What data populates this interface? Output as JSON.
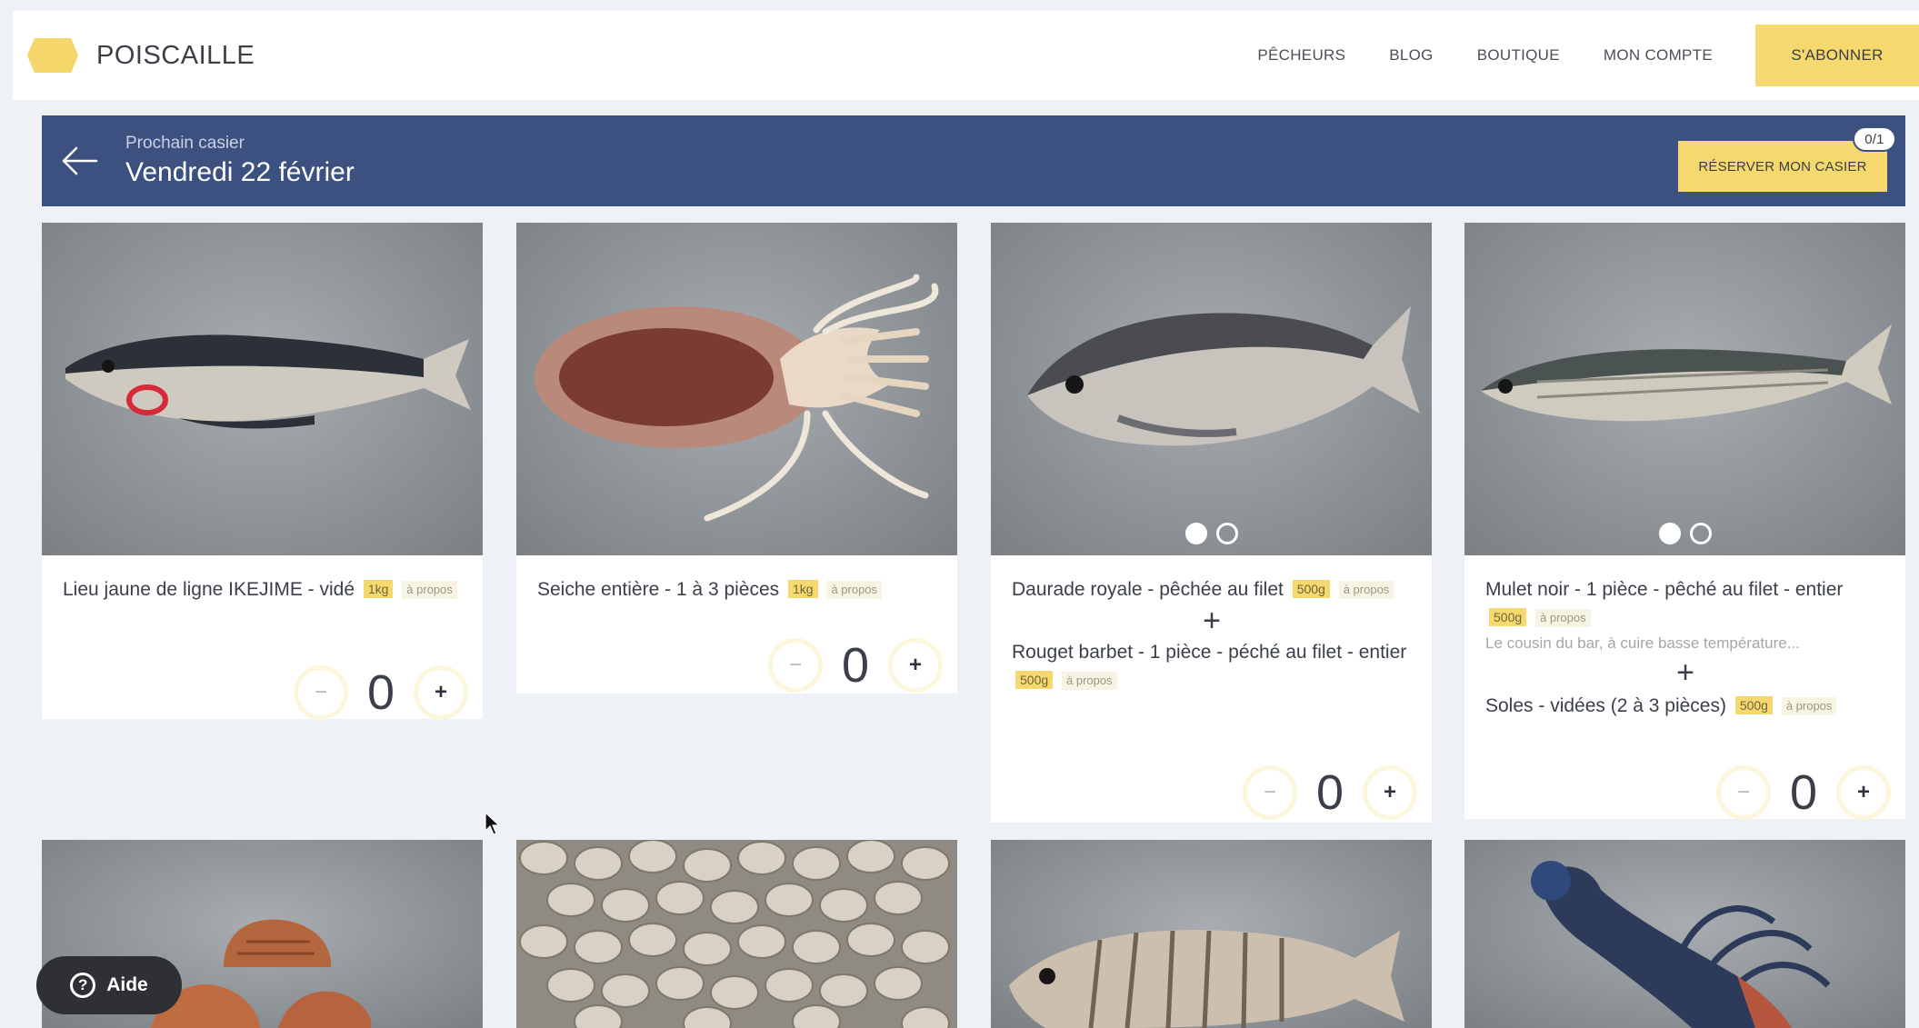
{
  "brand": {
    "name": "POISCAILLE",
    "color": "#f4d66b"
  },
  "nav": {
    "items": [
      "PÊCHEURS",
      "BLOG",
      "BOUTIQUE",
      "MON COMPTE"
    ],
    "subscribe": "S'ABONNER"
  },
  "banner": {
    "label": "Prochain casier",
    "date": "Vendredi 22 février",
    "reserve": "RÉSERVER MON CASIER",
    "badge": "0/1",
    "color": "#3c5180"
  },
  "cards": [
    {
      "photo_icon": "pollock-photo",
      "items": [
        {
          "title": "Lieu jaune de ligne IKEJIME - vidé",
          "weight": "1kg",
          "about": "à propos"
        }
      ],
      "quantity": "0"
    },
    {
      "photo_icon": "cuttlefish-photo",
      "items": [
        {
          "title": "Seiche entière - 1 à 3 pièces",
          "weight": "1kg",
          "about": "à propos"
        }
      ],
      "quantity": "0"
    },
    {
      "photo_icon": "sea-bream-photo",
      "carousel": {
        "count": 2,
        "active": 1
      },
      "items": [
        {
          "title": "Daurade royale - pêchée au filet",
          "weight": "500g",
          "about": "à propos"
        },
        {
          "title": "Rouget barbet - 1 pièce - péché au filet - entier",
          "weight": "500g",
          "about": "à propos"
        }
      ],
      "separator": "+",
      "quantity": "0"
    },
    {
      "photo_icon": "mullet-photo",
      "carousel": {
        "count": 2,
        "active": 1
      },
      "items": [
        {
          "title": "Mulet noir - 1 pièce - pêché au filet - entier",
          "weight": "500g",
          "about": "à propos",
          "description": "Le cousin du bar, à cuire basse température..."
        },
        {
          "title": "Soles - vidées (2 à 3 pièces)",
          "weight": "500g",
          "about": "à propos"
        }
      ],
      "separator": "+",
      "quantity": "0"
    }
  ],
  "bottom_photos": [
    "scallops-photo",
    "clams-photo",
    "striped-bream-photo",
    "lobster-photo"
  ],
  "stepper": {
    "minus": "−",
    "plus": "+"
  },
  "help": {
    "icon": "?",
    "label": "Aide"
  }
}
